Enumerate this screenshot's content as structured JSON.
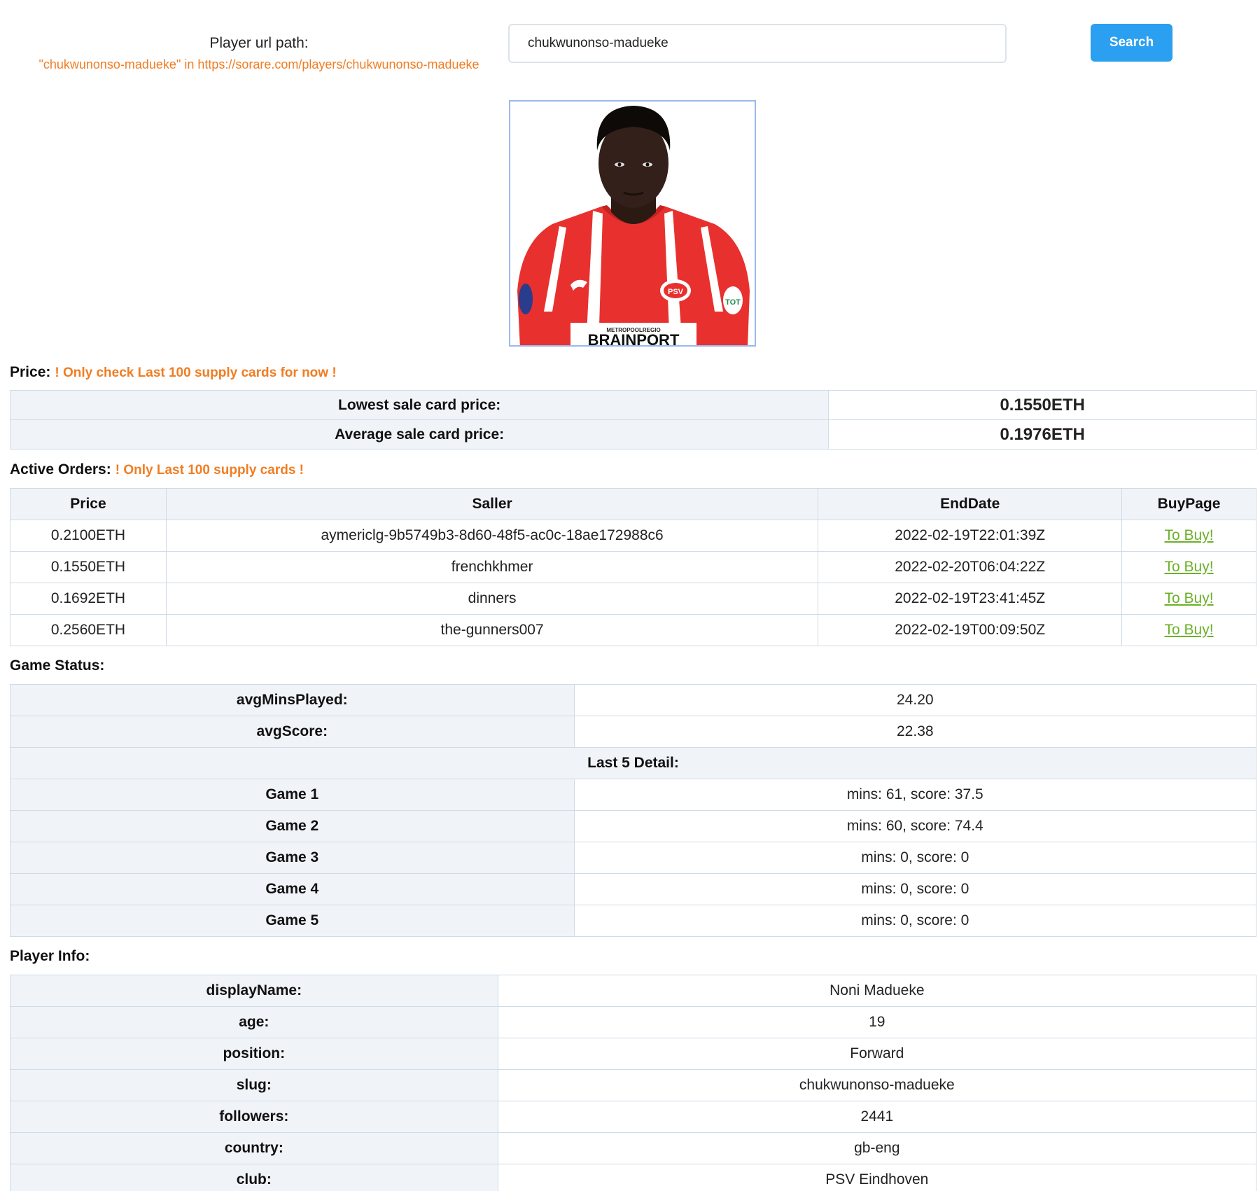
{
  "header": {
    "url_label": "Player url path:",
    "url_hint": "\"chukwunonso-madueke\" in https://sorare.com/players/chukwunonso-madueke",
    "search_value": "chukwunonso-madueke",
    "search_button": "Search"
  },
  "price": {
    "title": "Price:",
    "warning": "! Only check Last 100 supply cards for now !",
    "rows": [
      {
        "label": "Lowest sale card price:",
        "value": "0.1550ETH"
      },
      {
        "label": "Average sale card price:",
        "value": "0.1976ETH"
      }
    ]
  },
  "orders": {
    "title": "Active Orders:",
    "warning": "! Only Last 100 supply cards !",
    "headers": [
      "Price",
      "Saller",
      "EndDate",
      "BuyPage"
    ],
    "rows": [
      {
        "price": "0.2100ETH",
        "seller": "aymericlg-9b5749b3-8d60-48f5-ac0c-18ae172988c6",
        "end": "2022-02-19T22:01:39Z",
        "buy": "To Buy!"
      },
      {
        "price": "0.1550ETH",
        "seller": "frenchkhmer",
        "end": "2022-02-20T06:04:22Z",
        "buy": "To Buy!"
      },
      {
        "price": "0.1692ETH",
        "seller": "dinners",
        "end": "2022-02-19T23:41:45Z",
        "buy": "To Buy!"
      },
      {
        "price": "0.2560ETH",
        "seller": "the-gunners007",
        "end": "2022-02-19T00:09:50Z",
        "buy": "To Buy!"
      }
    ]
  },
  "game": {
    "title": "Game Status:",
    "avg_mins_label": "avgMinsPlayed:",
    "avg_mins": "24.20",
    "avg_score_label": "avgScore:",
    "avg_score": "22.38",
    "last5_label": "Last 5 Detail:",
    "games": [
      {
        "label": "Game 1",
        "value": "mins: 61, score: 37.5"
      },
      {
        "label": "Game 2",
        "value": "mins: 60, score: 74.4"
      },
      {
        "label": "Game 3",
        "value": "mins: 0, score: 0"
      },
      {
        "label": "Game 4",
        "value": "mins: 0, score: 0"
      },
      {
        "label": "Game 5",
        "value": "mins: 0, score: 0"
      }
    ]
  },
  "info": {
    "title": "Player Info:",
    "rows": [
      {
        "label": "displayName:",
        "value": "Noni Madueke"
      },
      {
        "label": "age:",
        "value": "19"
      },
      {
        "label": "position:",
        "value": "Forward"
      },
      {
        "label": "slug:",
        "value": "chukwunonso-madueke"
      },
      {
        "label": "followers:",
        "value": "2441"
      },
      {
        "label": "country:",
        "value": "gb-eng"
      },
      {
        "label": "club:",
        "value": "PSV Eindhoven"
      }
    ]
  },
  "photo": {
    "jersey_sponsor_small": "METROPOOLREGIO",
    "jersey_sponsor": "BRAINPORT",
    "badge": "PSV",
    "sleeve": "TOT"
  },
  "colors": {
    "accent_orange": "#f07d23",
    "search_blue": "#2b9ff0",
    "price_low": "#e5294a",
    "price_avg": "#e040e8",
    "link_green": "#6bb02a"
  }
}
